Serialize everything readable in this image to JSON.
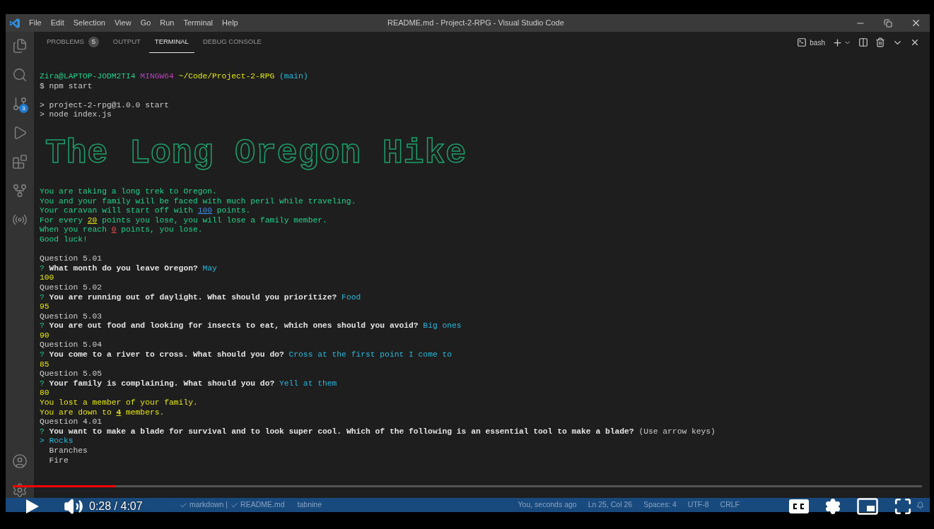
{
  "window": {
    "title": "README.md - Project-2-RPG - Visual Studio Code",
    "menu": [
      "File",
      "Edit",
      "Selection",
      "View",
      "Go",
      "Run",
      "Terminal",
      "Help"
    ]
  },
  "activity_bar": {
    "source_control_badge": "3"
  },
  "panel": {
    "tabs": [
      {
        "label": "PROBLEMS",
        "badge": "5",
        "selected": false
      },
      {
        "label": "OUTPUT",
        "selected": false
      },
      {
        "label": "TERMINAL",
        "selected": true
      },
      {
        "label": "DEBUG CONSOLE",
        "selected": false
      }
    ],
    "terminal_name": "bash"
  },
  "terminal": {
    "lines": [
      {
        "kind": "text",
        "segments": [
          {
            "kind": "green",
            "text": "Zira@LAPTOP-JODM2TI4"
          },
          {
            "kind": "magenta",
            "text": " MINGW64"
          },
          {
            "kind": "yellow",
            "text": " ~/Code/Project-2-RPG"
          },
          {
            "kind": "cyan",
            "text": " (main)"
          }
        ]
      },
      {
        "kind": "text",
        "segments": [
          {
            "kind": "plain",
            "text": "$ npm start"
          }
        ]
      },
      {
        "kind": "blank"
      },
      {
        "kind": "text",
        "segments": [
          {
            "kind": "plain",
            "text": "> project-2-rpg@1.0.0 start"
          }
        ]
      },
      {
        "kind": "text",
        "segments": [
          {
            "kind": "plain",
            "text": "> node index.js"
          }
        ]
      },
      {
        "kind": "banner",
        "text": "The Long Oregon Hike"
      },
      {
        "kind": "text",
        "segments": [
          {
            "kind": "green",
            "text": "You are taking a long trek to Oregon."
          }
        ]
      },
      {
        "kind": "text",
        "segments": [
          {
            "kind": "green",
            "text": "You and your family will be faced with much peril while traveling."
          }
        ]
      },
      {
        "kind": "text",
        "segments": [
          {
            "kind": "green",
            "text": "Your caravan will start off with "
          },
          {
            "kind": "num_blue",
            "text": "100"
          },
          {
            "kind": "green",
            "text": " points."
          }
        ]
      },
      {
        "kind": "text",
        "segments": [
          {
            "kind": "green",
            "text": "For every "
          },
          {
            "kind": "num_yellow",
            "text": "20"
          },
          {
            "kind": "green",
            "text": " points you lose, you will lose a family member."
          }
        ]
      },
      {
        "kind": "text",
        "segments": [
          {
            "kind": "green",
            "text": "When you reach "
          },
          {
            "kind": "num_red",
            "text": "0"
          },
          {
            "kind": "green",
            "text": " points, you lose."
          }
        ]
      },
      {
        "kind": "text",
        "segments": [
          {
            "kind": "green",
            "text": "Good luck!"
          }
        ]
      },
      {
        "kind": "blank"
      },
      {
        "kind": "text",
        "segments": [
          {
            "kind": "plain",
            "text": "Question 5.01"
          }
        ]
      },
      {
        "kind": "text",
        "segments": [
          {
            "kind": "mark",
            "text": "? "
          },
          {
            "kind": "bold",
            "text": "What month do you leave Oregon?"
          },
          {
            "kind": "answer",
            "text": " May"
          }
        ]
      },
      {
        "kind": "text",
        "segments": [
          {
            "kind": "score",
            "text": "100"
          }
        ]
      },
      {
        "kind": "text",
        "segments": [
          {
            "kind": "plain",
            "text": "Question 5.02"
          }
        ]
      },
      {
        "kind": "text",
        "segments": [
          {
            "kind": "mark",
            "text": "? "
          },
          {
            "kind": "bold",
            "text": "You are running out of daylight. What should you prioritize?"
          },
          {
            "kind": "answer",
            "text": " Food"
          }
        ]
      },
      {
        "kind": "text",
        "segments": [
          {
            "kind": "score",
            "text": "95"
          }
        ]
      },
      {
        "kind": "text",
        "segments": [
          {
            "kind": "plain",
            "text": "Question 5.03"
          }
        ]
      },
      {
        "kind": "text",
        "segments": [
          {
            "kind": "mark",
            "text": "? "
          },
          {
            "kind": "bold",
            "text": "You are out food and looking for insects to eat, which ones should you avoid?"
          },
          {
            "kind": "answer",
            "text": " Big ones"
          }
        ]
      },
      {
        "kind": "text",
        "segments": [
          {
            "kind": "score",
            "text": "90"
          }
        ]
      },
      {
        "kind": "text",
        "segments": [
          {
            "kind": "plain",
            "text": "Question 5.04"
          }
        ]
      },
      {
        "kind": "text",
        "segments": [
          {
            "kind": "mark",
            "text": "? "
          },
          {
            "kind": "bold",
            "text": "You come to a river to cross. What should you do?"
          },
          {
            "kind": "answer",
            "text": " Cross at the first point I come to"
          }
        ]
      },
      {
        "kind": "text",
        "segments": [
          {
            "kind": "score",
            "text": "85"
          }
        ]
      },
      {
        "kind": "text",
        "segments": [
          {
            "kind": "plain",
            "text": "Question 5.05"
          }
        ]
      },
      {
        "kind": "text",
        "segments": [
          {
            "kind": "mark",
            "text": "? "
          },
          {
            "kind": "bold",
            "text": "Your family is complaining. What should you do?"
          },
          {
            "kind": "answer",
            "text": " Yell at them"
          }
        ]
      },
      {
        "kind": "text",
        "segments": [
          {
            "kind": "score",
            "text": "80"
          }
        ]
      },
      {
        "kind": "text",
        "segments": [
          {
            "kind": "score",
            "text": "You lost a member of your family."
          }
        ]
      },
      {
        "kind": "text",
        "segments": [
          {
            "kind": "score",
            "text": "You are down to "
          },
          {
            "kind": "num_score",
            "text": "4"
          },
          {
            "kind": "score",
            "text": " members."
          }
        ]
      },
      {
        "kind": "text",
        "segments": [
          {
            "kind": "plain",
            "text": "Question 4.01"
          }
        ]
      },
      {
        "kind": "text",
        "segments": [
          {
            "kind": "mark",
            "text": "? "
          },
          {
            "kind": "bold",
            "text": "You want to make a blade for survival and to look super cool. Which of the following is an essential tool to make a blade?"
          },
          {
            "kind": "plain",
            "text": " (Use arrow keys)"
          }
        ]
      }
    ],
    "pointer": ">",
    "choices": [
      {
        "label": "Rocks",
        "selected": true
      },
      {
        "label": "Branches",
        "selected": false
      },
      {
        "label": "Fire",
        "selected": false
      }
    ]
  },
  "status_bar": {
    "left": [
      "markdown |",
      "README.md",
      "tabnine"
    ],
    "right": [
      "You, seconds ago",
      "Ln 25, Col 26",
      "Spaces: 4",
      "UTF-8",
      "CRLF"
    ]
  },
  "player": {
    "time": "0:28 / 4:07",
    "level": 0.113
  }
}
